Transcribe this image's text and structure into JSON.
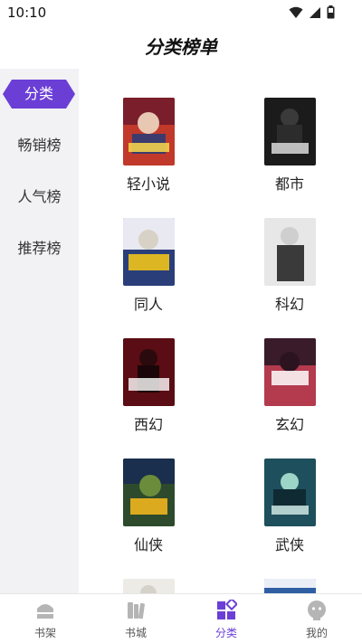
{
  "status": {
    "time": "10:10"
  },
  "header": {
    "title": "分类榜单"
  },
  "sidebar": {
    "items": [
      {
        "label": "分类",
        "active": true
      },
      {
        "label": "畅销榜",
        "active": false
      },
      {
        "label": "人气榜",
        "active": false
      },
      {
        "label": "推荐榜",
        "active": false
      }
    ]
  },
  "categories": [
    {
      "label": "轻小说",
      "cover_color": "#c0392b"
    },
    {
      "label": "都市",
      "cover_color": "#1b1b1b"
    },
    {
      "label": "同人",
      "cover_color": "#2a3f7a"
    },
    {
      "label": "科幻",
      "cover_color": "#e7e7e7"
    },
    {
      "label": "西幻",
      "cover_color": "#5a0d14"
    },
    {
      "label": "玄幻",
      "cover_color": "#b43a4d"
    },
    {
      "label": "仙侠",
      "cover_color": "#2d4a2c"
    },
    {
      "label": "武侠",
      "cover_color": "#1e4f5c"
    }
  ],
  "tabbar": {
    "items": [
      {
        "label": "书架",
        "icon": "bookshelf-icon",
        "active": false
      },
      {
        "label": "书城",
        "icon": "bookstore-icon",
        "active": false
      },
      {
        "label": "分类",
        "icon": "category-icon",
        "active": true
      },
      {
        "label": "我的",
        "icon": "profile-icon",
        "active": false
      }
    ]
  },
  "colors": {
    "accent": "#6b3fd6",
    "sidebar_bg": "#f2f2f4"
  }
}
